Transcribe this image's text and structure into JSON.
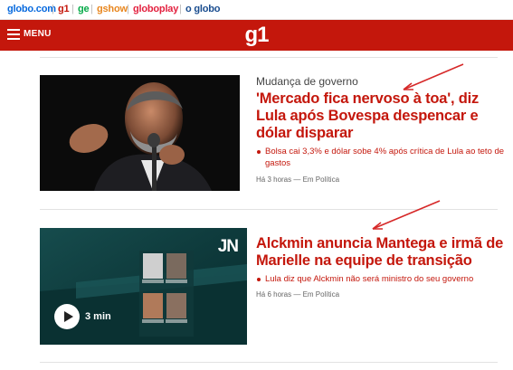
{
  "network_bar": {
    "items": [
      "globo.com",
      "g1",
      "ge",
      "gshow",
      "globoplay",
      "o globo"
    ],
    "separator": "|"
  },
  "header": {
    "menu_label": "MENU",
    "logo": "g1",
    "color": "#c4170c"
  },
  "articles": [
    {
      "kicker": "Mudança de governo",
      "headline": "'Mercado fica nervoso à toa', diz Lula após Bovespa despencar e dólar disparar",
      "related": "Bolsa cai 3,3% e dólar sobe 4% após crítica de Lula ao teto de gastos",
      "meta": "Há 3 horas — Em Política",
      "media": "photo"
    },
    {
      "kicker": "",
      "headline": "Alckmin anuncia Mantega e irmã de Marielle na equipe de transição",
      "related": "Lula diz que Alckmin não será ministro do seu governo",
      "meta": "Há 6 horas — Em Política",
      "media": "video",
      "video_badge": "JN",
      "video_duration": "3 min"
    }
  ],
  "annotation_color": "#d62828"
}
